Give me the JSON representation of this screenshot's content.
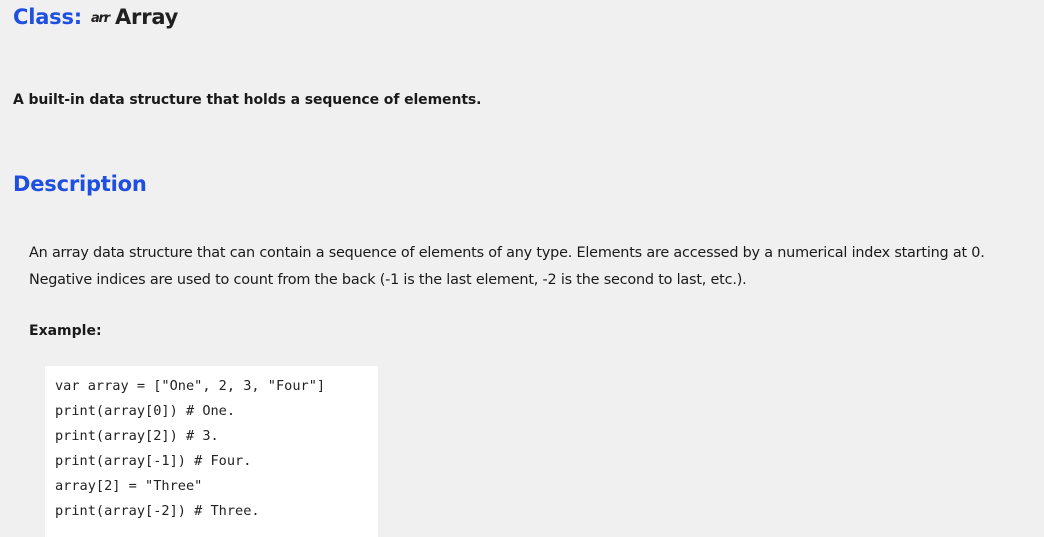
{
  "header": {
    "prefix": "Class:",
    "icon": "arr",
    "name": "Array"
  },
  "brief_description": "A built-in data structure that holds a sequence of elements.",
  "description_section": {
    "heading": "Description",
    "lines": [
      "An array data structure that can contain a sequence of elements of any type. Elements are accessed by a numerical index starting at 0.",
      "Negative indices are used to count from the back (-1 is the last element, -2 is the second to last, etc.)."
    ]
  },
  "example": {
    "label": "Example:",
    "code_lines": [
      "var array = [\"One\", 2, 3, \"Four\"]",
      "print(array[0]) # One.",
      "print(array[2]) # 3.",
      "print(array[-1]) # Four.",
      "array[2] = \"Three\"",
      "print(array[-2]) # Three."
    ]
  }
}
